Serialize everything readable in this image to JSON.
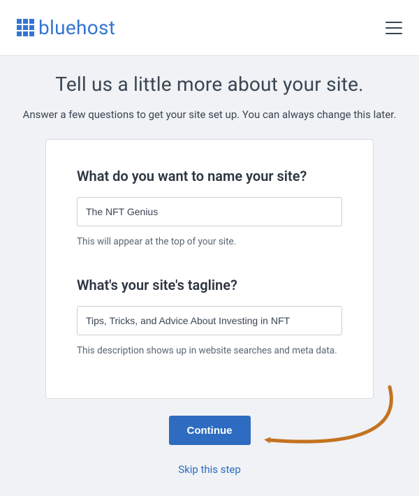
{
  "brand": {
    "name": "bluehost"
  },
  "page": {
    "heading": "Tell us a little more about your site.",
    "subheading": "Answer a few questions to get your site set up. You can always change this later."
  },
  "form": {
    "site_name": {
      "label": "What do you want to name your site?",
      "value": "The NFT Genius",
      "helper": "This will appear at the top of your site."
    },
    "tagline": {
      "label": "What's your site's tagline?",
      "value": "Tips, Tricks, and Advice About Investing in NFT",
      "helper": "This description shows up in website searches and meta data."
    }
  },
  "actions": {
    "continue_label": "Continue",
    "skip_label": "Skip this step"
  }
}
